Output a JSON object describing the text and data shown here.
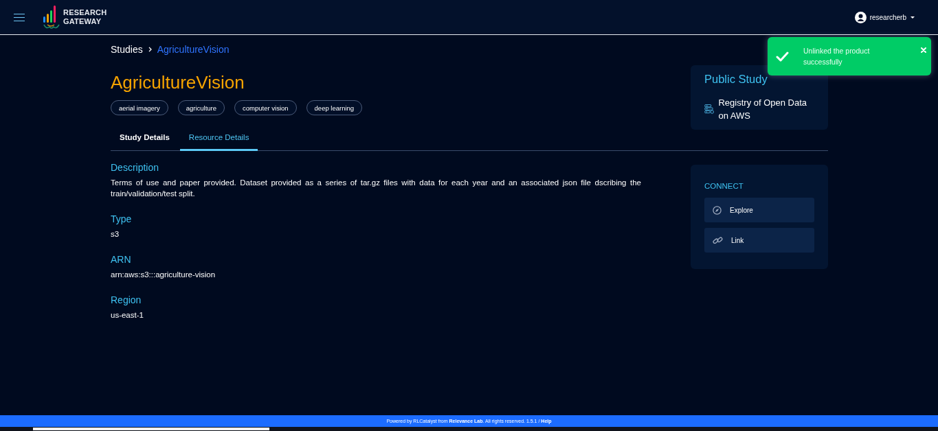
{
  "header": {
    "brand_lines": [
      "RESEARCH",
      "GATEWAY"
    ],
    "user": "researcherb"
  },
  "toast": {
    "message": "Unlinked the product successfully"
  },
  "breadcrumb": [
    {
      "label": "Studies",
      "current": false
    },
    {
      "label": "AgricultureVision",
      "current": true
    }
  ],
  "study": {
    "title": "AgricultureVision",
    "tags": [
      "aerial imagery",
      "agriculture",
      "computer vision",
      "deep learning"
    ]
  },
  "tabs": [
    {
      "label": "Study Details",
      "selected": false
    },
    {
      "label": "Resource Details",
      "selected": true
    }
  ],
  "details": [
    {
      "label": "Description",
      "value": "Terms of use and paper provided. Dataset provided as a series of tar.gz files with data for each year and an associated json file dscribing the train/validation/test split."
    },
    {
      "label": "Type",
      "value": "s3"
    },
    {
      "label": "ARN",
      "value": "arn:aws:s3:::agriculture-vision"
    },
    {
      "label": "Region",
      "value": "us-east-1"
    }
  ],
  "public_study": {
    "title": "Public Study",
    "source": "Registry of Open Data on AWS"
  },
  "connect": {
    "title": "CONNECT",
    "actions": [
      {
        "label": "Explore"
      },
      {
        "label": "Link"
      }
    ]
  },
  "footer": {
    "text": "Powered by RLCatalyst from **Relevance Lab**. All rights reserved. 1.5.1 /",
    "link": "Help"
  }
}
